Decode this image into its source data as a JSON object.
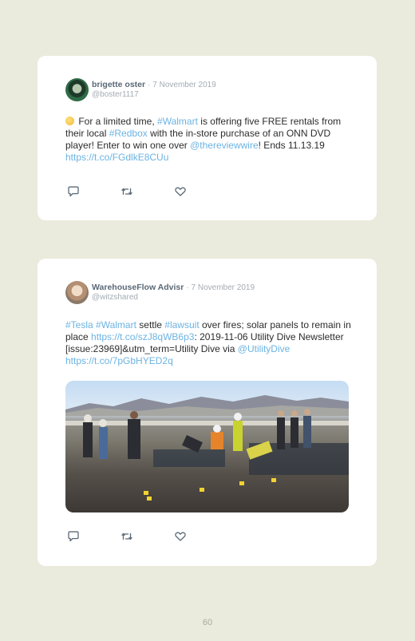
{
  "tweets": [
    {
      "name": "brigette oster",
      "separator": "·",
      "date": "7 November 2019",
      "handle": "@boster1117",
      "avatar_icon": "profile-photo",
      "text": {
        "t1": " For a limited time, ",
        "h1": "#Walmart",
        "t2": " is offering five FREE rentals from their local ",
        "h2": "#Redbox",
        "t3": " with the in-store purchase of an ONN DVD player! Enter to win one over ",
        "m1": "@thereviewwire",
        "t4": "! Ends 11.13.19 ",
        "u1": "https://t.co/FGdlkE8CUu"
      }
    },
    {
      "name": "WarehouseFlow Advisr",
      "separator": "·",
      "date": "7 November 2019",
      "handle": "@witzshared",
      "avatar_icon": "profile-photo",
      "text": {
        "h1": "#Tesla",
        "t1": " ",
        "h2": "#Walmart",
        "t2": " settle ",
        "h3": "#lawsuit",
        "t3": " over fires; solar panels to remain in place ",
        "u1": "https://t.co/szJ8qWB6p3",
        "t4": ": 2019-11-06 Utility Dive Newsletter [issue:23969]&utm_term=Utility Dive via ",
        "m1": "@UtilityDive",
        "t5": " ",
        "u2": "https://t.co/7pGbHYED2q"
      },
      "image": "rooftop-solar-panel-inspection-photo"
    }
  ],
  "actions": [
    "reply-icon",
    "retweet-icon",
    "like-icon"
  ],
  "colors": {
    "background": "#ebebdd",
    "link": "#6cb3e2",
    "name": "#5a6977",
    "muted": "#a3acb3"
  },
  "page_number": "60"
}
